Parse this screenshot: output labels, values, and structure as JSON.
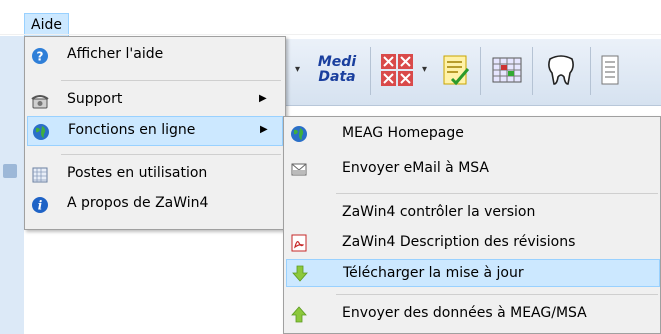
{
  "menubar": {
    "aide_label": "Aide"
  },
  "toolbar": {
    "medidata_line1": "Medi",
    "medidata_line2": "Data"
  },
  "menu": {
    "items": [
      {
        "label": "Afficher l'aide",
        "icon": "help-icon"
      },
      {
        "label": "Support",
        "icon": "phone-icon",
        "has_submenu": true
      },
      {
        "label": "Fonctions en ligne",
        "icon": "globe-icon",
        "has_submenu": true,
        "active": true
      },
      {
        "label": "Postes en utilisation",
        "icon": "workstations-icon"
      },
      {
        "label": "A propos de  ZaWin4",
        "icon": "info-icon"
      }
    ]
  },
  "submenu": {
    "items": [
      {
        "label": "MEAG Homepage",
        "icon": "globe-icon"
      },
      {
        "label": "Envoyer eMail à MSA",
        "icon": "mail-icon"
      },
      {
        "label": "ZaWin4 contrôler la version",
        "icon": ""
      },
      {
        "label": "ZaWin4 Description des révisions",
        "icon": "pdf-icon"
      },
      {
        "label": "Télécharger la mise à jour",
        "icon": "download-arrow-icon",
        "active": true
      },
      {
        "label": "Envoyer des données à MEAG/MSA",
        "icon": "upload-arrow-icon"
      }
    ]
  },
  "colors": {
    "highlight": "#cce8ff",
    "highlight_border": "#99d1ff",
    "menu_bg": "#f0f0f0"
  }
}
